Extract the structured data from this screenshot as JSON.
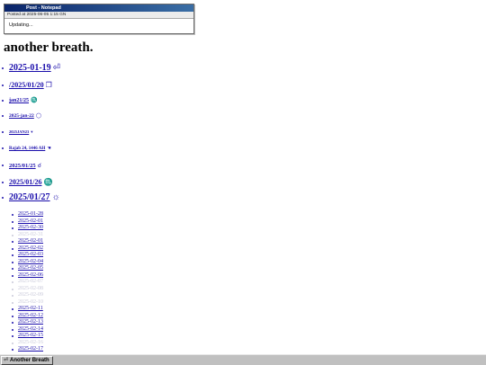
{
  "window": {
    "title": "Post - Notepad",
    "posted_at": "Posted at 2025-06-05 1:15 GN",
    "body": "Updating..."
  },
  "page": {
    "heading": "another breath."
  },
  "posts": [
    {
      "label": "2025-01-19",
      "icon": "⏎",
      "icon_name": "return-icon"
    },
    {
      "label": "/2025/01/20",
      "icon": "❐",
      "icon_name": "window-icon"
    },
    {
      "label": "jan21/25",
      "icon": "♏",
      "icon_name": "scorpio-icon"
    },
    {
      "label": "2025-jan-22",
      "icon": "◯",
      "icon_name": "circle-icon"
    },
    {
      "label": "2025JAN23",
      "icon": "▾",
      "icon_name": "triangle-down-icon"
    },
    {
      "label": "Rajab 24, 1446 AH",
      "icon": "☚",
      "icon_name": "hand-icon"
    },
    {
      "label": "2025/01/25",
      "icon": "☌",
      "icon_name": "conjunction-icon"
    },
    {
      "label": "2025/01/26",
      "icon": "♏",
      "icon_name": "scorpio-icon"
    },
    {
      "label": "2025/01/27",
      "icon": "☼",
      "icon_name": "sun-icon"
    }
  ],
  "archive": [
    {
      "label": "2025-01-28",
      "faded": false
    },
    {
      "label": "2025-02-01",
      "faded": false
    },
    {
      "label": "2025-02-30",
      "faded": false
    },
    {
      "label": "2025-02-31",
      "faded": true
    },
    {
      "label": "2025-02-01",
      "faded": false
    },
    {
      "label": "2025-02-02",
      "faded": false
    },
    {
      "label": "2025-02-03",
      "faded": false
    },
    {
      "label": "2025-02-04",
      "faded": false
    },
    {
      "label": "2025-02-05",
      "faded": false
    },
    {
      "label": "2025-02-06",
      "faded": false
    },
    {
      "label": "2025-02-07",
      "faded": true
    },
    {
      "label": "2025-02-08",
      "faded": true
    },
    {
      "label": "2025-02-09",
      "faded": true
    },
    {
      "label": "2025-02-10",
      "faded": true
    },
    {
      "label": "2025-02-11",
      "faded": false
    },
    {
      "label": "2025-02-12",
      "faded": false
    },
    {
      "label": "2025-02-13",
      "faded": false
    },
    {
      "label": "2025-02-14",
      "faded": false
    },
    {
      "label": "2025-02-15",
      "faded": false
    },
    {
      "label": "2025-02-16",
      "faded": true
    },
    {
      "label": "2025-02-17",
      "faded": false
    }
  ],
  "taskbar": {
    "button": "Another Breath",
    "icon": "⏎"
  }
}
